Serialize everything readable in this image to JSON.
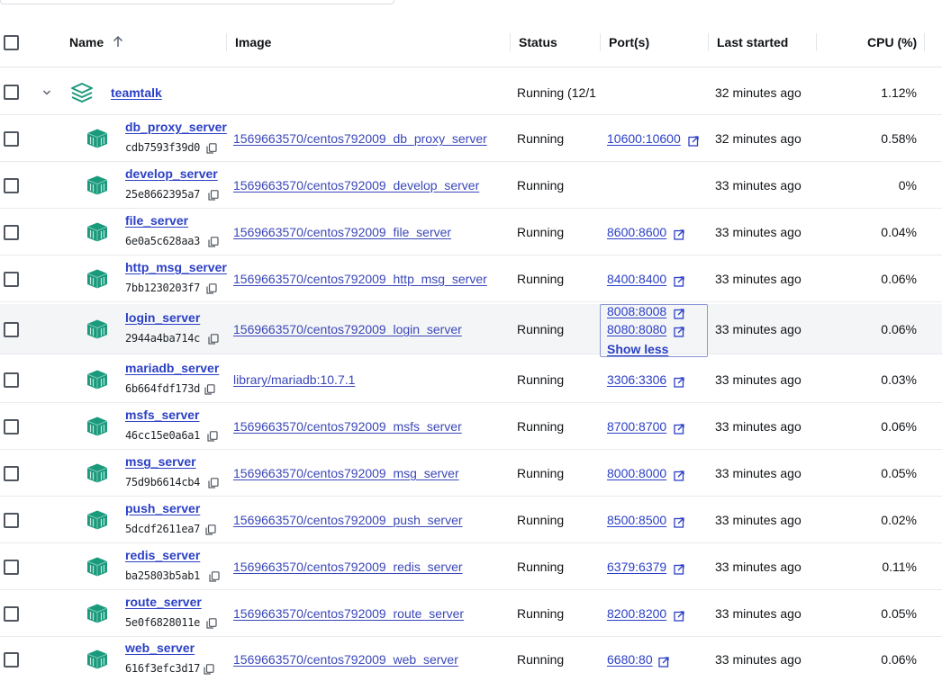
{
  "header": {
    "name": "Name",
    "image": "Image",
    "status": "Status",
    "ports": "Port(s)",
    "last_started": "Last started",
    "cpu": "CPU (%)"
  },
  "group": {
    "name": "teamtalk",
    "status": "Running (12/1",
    "last_started": "32 minutes ago",
    "cpu": "1.12%"
  },
  "containers": [
    {
      "name": "db_proxy_server",
      "id": "cdb7593f39d0",
      "image": "1569663570/centos792009_db_proxy_server",
      "status": "Running",
      "ports": [
        "10600:10600"
      ],
      "last_started": "32 minutes ago",
      "cpu": "0.58%"
    },
    {
      "name": "develop_server",
      "id": "25e8662395a7",
      "image": "1569663570/centos792009_develop_server",
      "status": "Running",
      "ports": [],
      "last_started": "33 minutes ago",
      "cpu": "0%"
    },
    {
      "name": "file_server",
      "id": "6e0a5c628aa3",
      "image": "1569663570/centos792009_file_server",
      "status": "Running",
      "ports": [
        "8600:8600"
      ],
      "last_started": "33 minutes ago",
      "cpu": "0.04%"
    },
    {
      "name": "http_msg_server",
      "id": "7bb1230203f7",
      "image": "1569663570/centos792009_http_msg_server",
      "status": "Running",
      "ports": [
        "8400:8400"
      ],
      "last_started": "33 minutes ago",
      "cpu": "0.06%"
    },
    {
      "name": "login_server",
      "id": "2944a4ba714c",
      "image": "1569663570/centos792009_login_server",
      "status": "Running",
      "ports": [
        "8008:8008",
        "8080:8080"
      ],
      "show_less": "Show less",
      "last_started": "33 minutes ago",
      "cpu": "0.06%"
    },
    {
      "name": "mariadb_server",
      "id": "6b664fdf173d",
      "image": "library/mariadb:10.7.1",
      "status": "Running",
      "ports": [
        "3306:3306"
      ],
      "last_started": "33 minutes ago",
      "cpu": "0.03%"
    },
    {
      "name": "msfs_server",
      "id": "46cc15e0a6a1",
      "image": "1569663570/centos792009_msfs_server",
      "status": "Running",
      "ports": [
        "8700:8700"
      ],
      "last_started": "33 minutes ago",
      "cpu": "0.06%"
    },
    {
      "name": "msg_server",
      "id": "75d9b6614cb4",
      "image": "1569663570/centos792009_msg_server",
      "status": "Running",
      "ports": [
        "8000:8000"
      ],
      "last_started": "33 minutes ago",
      "cpu": "0.05%"
    },
    {
      "name": "push_server",
      "id": "5dcdf2611ea7",
      "image": "1569663570/centos792009_push_server",
      "status": "Running",
      "ports": [
        "8500:8500"
      ],
      "last_started": "33 minutes ago",
      "cpu": "0.02%"
    },
    {
      "name": "redis_server",
      "id": "ba25803b5ab1",
      "image": "1569663570/centos792009_redis_server",
      "status": "Running",
      "ports": [
        "6379:6379"
      ],
      "last_started": "33 minutes ago",
      "cpu": "0.11%"
    },
    {
      "name": "route_server",
      "id": "5e0f6828011e",
      "image": "1569663570/centos792009_route_server",
      "status": "Running",
      "ports": [
        "8200:8200"
      ],
      "last_started": "33 minutes ago",
      "cpu": "0.05%"
    },
    {
      "name": "web_server",
      "id": "616f3efc3d17",
      "image": "1569663570/centos792009_web_server",
      "status": "Running",
      "ports": [
        "6680:80"
      ],
      "last_started": "33 minutes ago",
      "cpu": "0.06%"
    }
  ],
  "colors": {
    "link": "#2b40c6",
    "container_icon": "#1a9a7c",
    "stack_icon": "#1a9a7c",
    "highlight_row": "#f4f5f7"
  },
  "icons": {
    "sort": "arrow-up-icon",
    "expand": "chevron-down-icon",
    "stack": "stack-icon",
    "container": "container-icon",
    "copy": "copy-icon",
    "external": "external-link-icon"
  }
}
